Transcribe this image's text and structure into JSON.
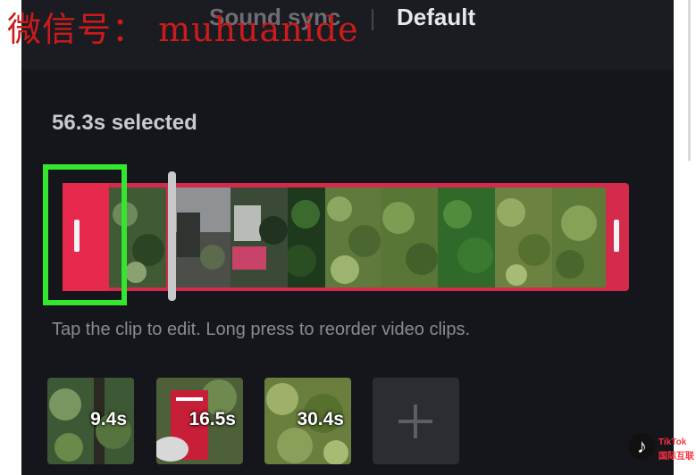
{
  "tabs": {
    "sound_sync": "Sound sync",
    "default": "Default"
  },
  "watermark": "微信号： muhuanide",
  "selection": {
    "label": "56.3s selected"
  },
  "hint": "Tap the clip to edit. Long press to reorder video clips.",
  "clips": [
    {
      "duration": "9.4s",
      "icon": "forest-thumbnail"
    },
    {
      "duration": "16.5s",
      "icon": "red-sign-thumbnail"
    },
    {
      "duration": "30.4s",
      "icon": "foliage-thumbnail"
    }
  ],
  "add_clip": {
    "icon": "plus-icon"
  },
  "badge": {
    "line1": "TikTok",
    "line2": "国际互联",
    "icon": "tiktok-note-icon"
  },
  "colors": {
    "accent": "#d42a4c",
    "handle": "#e6294d",
    "highlight": "#35e62f",
    "background": "#15161c"
  }
}
